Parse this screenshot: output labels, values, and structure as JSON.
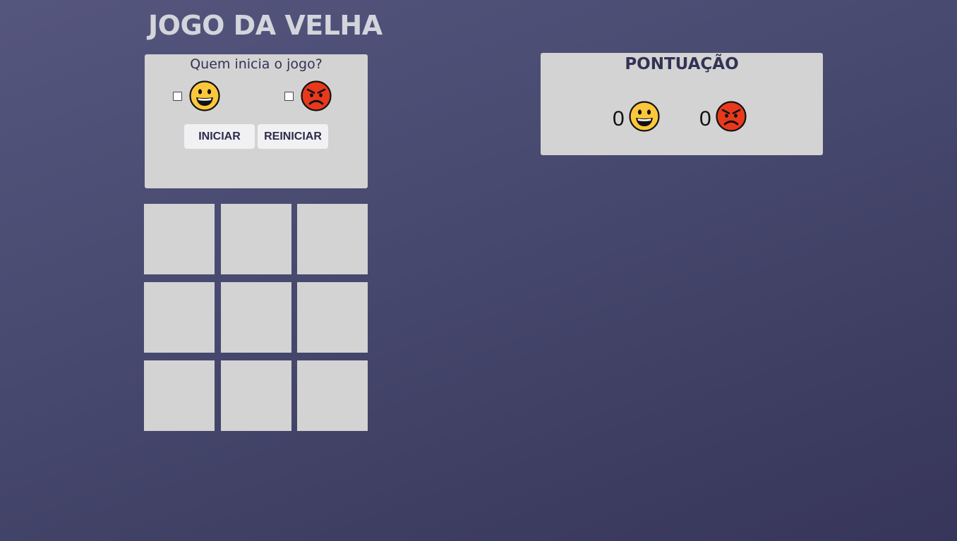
{
  "header": {
    "title": "JOGO DA VELHA"
  },
  "start_panel": {
    "question": "Quem inicia o jogo?",
    "options": [
      {
        "icon": "happy-face-icon",
        "checked": false
      },
      {
        "icon": "angry-face-icon",
        "checked": false
      }
    ],
    "start_label": "INICIAR",
    "restart_label": "REINICIAR"
  },
  "board": {
    "cells": [
      "",
      "",
      "",
      "",
      "",
      "",
      "",
      "",
      ""
    ]
  },
  "score_panel": {
    "title": "PONTUAÇÃO",
    "happy_score": "0",
    "angry_score": "0"
  },
  "colors": {
    "panel": "#d3d3d3",
    "accent_text": "#333356",
    "happy": "#fcc73a",
    "angry": "#e8391c"
  }
}
